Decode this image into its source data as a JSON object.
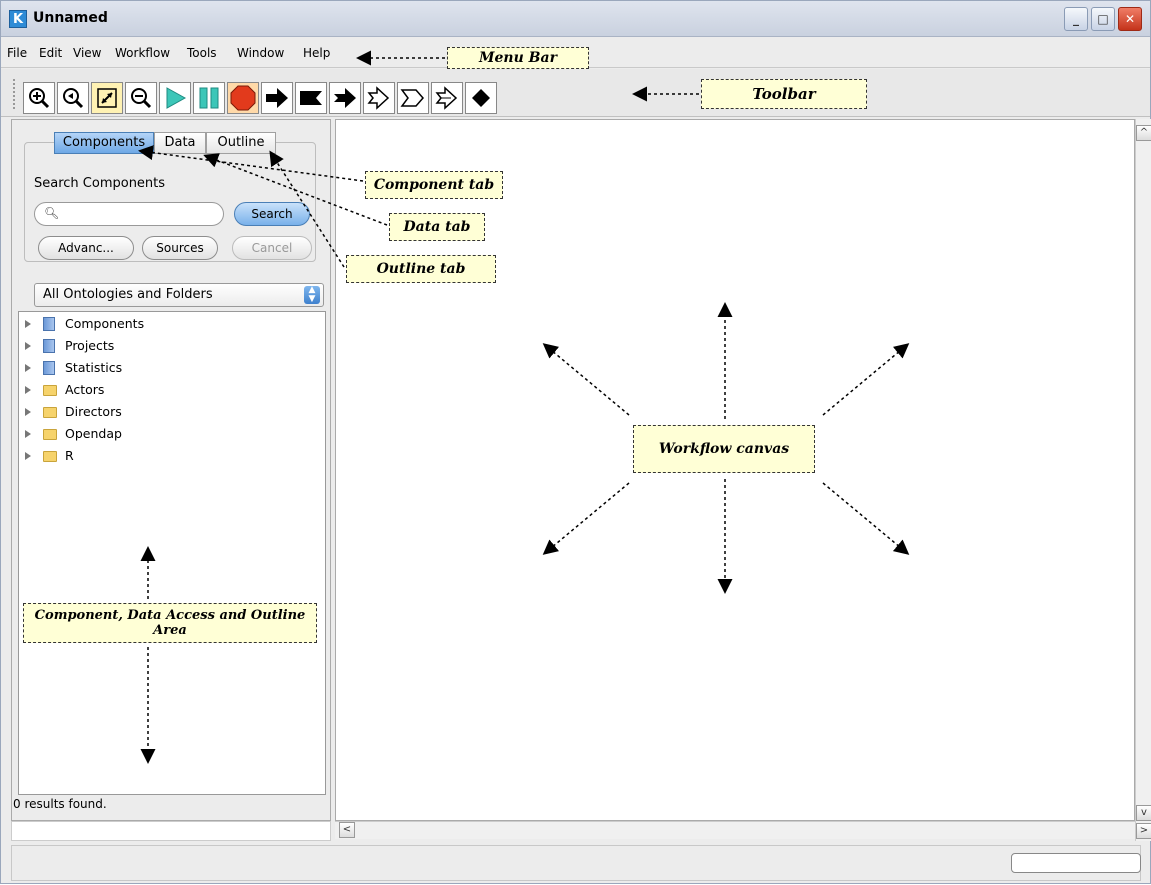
{
  "window": {
    "app_icon": "K",
    "title": "Unnamed",
    "minimize": "_",
    "maximize": "□",
    "close": "✕"
  },
  "menubar": {
    "items": [
      {
        "label": "File",
        "underline": "F"
      },
      {
        "label": "Edit",
        "underline": "E"
      },
      {
        "label": "View",
        "underline": "V"
      },
      {
        "label": "Workflow",
        "underline": "o"
      },
      {
        "label": "Tools",
        "underline": "T"
      },
      {
        "label": "Window",
        "underline": "W"
      },
      {
        "label": "Help",
        "underline": "H"
      }
    ]
  },
  "toolbar": {
    "buttons": [
      {
        "name": "zoom-in-icon"
      },
      {
        "name": "zoom-reset-icon"
      },
      {
        "name": "zoom-fit-icon"
      },
      {
        "name": "zoom-out-icon"
      },
      {
        "name": "run-icon"
      },
      {
        "name": "pause-icon"
      },
      {
        "name": "stop-icon"
      },
      {
        "name": "port-arrow-icon"
      },
      {
        "name": "port-flag-icon"
      },
      {
        "name": "port-arrow-notch-icon"
      },
      {
        "name": "port-double-chevron-icon"
      },
      {
        "name": "port-outline-flag-icon"
      },
      {
        "name": "port-outline-notch-icon"
      },
      {
        "name": "relation-diamond-icon"
      }
    ]
  },
  "left_panel": {
    "tabs": [
      {
        "label": "Components",
        "active": true
      },
      {
        "label": "Data",
        "active": false
      },
      {
        "label": "Outline",
        "active": false
      }
    ],
    "search_label": "Search Components",
    "search_value": "",
    "search_button": "Search",
    "advanced_button": "Advanc...",
    "sources_button": "Sources",
    "cancel_button": "Cancel",
    "ontology_select": "All Ontologies and Folders",
    "tree": [
      {
        "label": "Components",
        "icon": "book-icon"
      },
      {
        "label": "Projects",
        "icon": "book-icon"
      },
      {
        "label": "Statistics",
        "icon": "book-icon"
      },
      {
        "label": "Actors",
        "icon": "folder-icon"
      },
      {
        "label": "Directors",
        "icon": "folder-icon"
      },
      {
        "label": "Opendap",
        "icon": "folder-icon"
      },
      {
        "label": "R",
        "icon": "folder-icon"
      }
    ],
    "results": "0 results found."
  },
  "callouts": {
    "menu_bar": "Menu Bar",
    "toolbar": "Toolbar",
    "component_tab": "Component tab",
    "data_tab": "Data tab",
    "outline_tab": "Outline tab",
    "workflow_canvas": "Workflow canvas",
    "component_area_line1": "Component, Data Access and Outline",
    "component_area_line2": "Area"
  },
  "colors": {
    "accent": "#6ea8e6",
    "callout_bg": "#ffffd6",
    "stop_bg": "#ffd9a8"
  }
}
